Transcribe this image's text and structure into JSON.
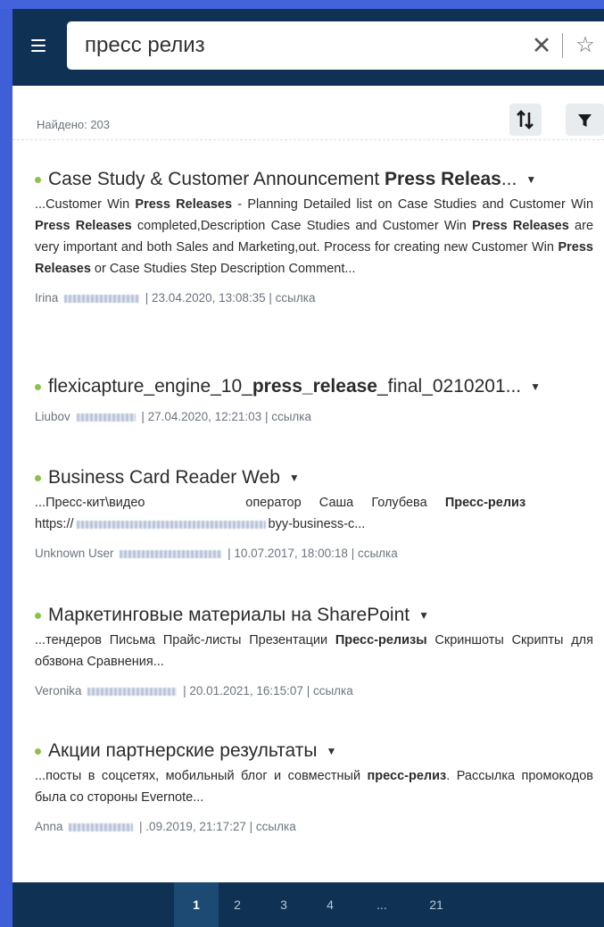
{
  "search": {
    "query": "пресс релиз"
  },
  "toolbar": {
    "found_label": "Найдено: 203"
  },
  "results": [
    {
      "title_before": "Case Study & Customer Announcement ",
      "title_bold": "Press Releas",
      "title_after": "...",
      "snippet_html": "...Customer Win <b>Press Releases</b> - Planning Detailed list on Case Studies and Customer Win <b>Press Releases</b> completed,Description Case Studies and Customer Win <b>Press Releases</b> are very important and both Sales and Marketing,out. Process for creating new Customer Win <b>Press Releases</b> or Case Studies Step Description Comment...",
      "author": "Irina",
      "date": "23.04.2020, 13:08:35",
      "link": "ссылка"
    },
    {
      "title_before": "flexicapture_engine_10_",
      "title_bold": "press_release",
      "title_after": "_final_0210201...",
      "snippet_html": "",
      "author": "Liubov",
      "date": "27.04.2020, 12:21:03",
      "link": "ссылка"
    },
    {
      "title_before": "Business Card Reader Web",
      "title_bold": "",
      "title_after": "",
      "snippet_html": "...Пресс-кит\\видео&nbsp;&nbsp;&nbsp;&nbsp;&nbsp;&nbsp;&nbsp;&nbsp;&nbsp;&nbsp;&nbsp;&nbsp;&nbsp;&nbsp;&nbsp;&nbsp;&nbsp;&nbsp;&nbsp;&nbsp;&nbsp;&nbsp;&nbsp;&nbsp;&nbsp;&nbsp;&nbsp;&nbsp;оператор&nbsp;&nbsp;&nbsp;&nbsp;&nbsp;Саша&nbsp;&nbsp;&nbsp;&nbsp;&nbsp;Голубева&nbsp;&nbsp;&nbsp;&nbsp;&nbsp;<b>Пресс-релиз</b><br>https://<span class=\"blur\" style=\"width:212px\"></span>byy-business-c...",
      "author": "Unknown User",
      "date": "10.07.2017, 18:00:18",
      "link": "ссылка"
    },
    {
      "title_before": "Маркетинговые материалы на SharePoint",
      "title_bold": "",
      "title_after": "",
      "snippet_html": "...тендеров Письма Прайс-листы Презентации <b>Пресс-релизы</b> Скриншоты Скрипты для обзвона Сравнения...",
      "author": "Veronika",
      "date": "20.01.2021, 16:15:07",
      "link": "ссылка"
    },
    {
      "title_before": "Акции партнерские результаты",
      "title_bold": "",
      "title_after": "",
      "snippet_html": "...посты в соцсетях, мобильный блог и совместный <b>пресс-релиз</b>. Рассылка промокодов была со стороны Evernote...",
      "author": "Anna",
      "date": ".09.2019, 21:17:27",
      "link": "ссылка"
    }
  ],
  "pagination": {
    "pages": [
      "1",
      "2",
      "3",
      "4",
      "...",
      "21"
    ],
    "active": "1"
  },
  "icons": {
    "menu": "hamburger-menu-icon",
    "clear": "close-icon",
    "favorite": "star-outline-icon",
    "sort": "sort-arrows-icon",
    "filter": "filter-funnel-icon",
    "expand": "caret-down-icon"
  },
  "colors": {
    "header": "#0f3254",
    "accent_dot": "#8bc34a",
    "page_bg": "#3f5fd8"
  }
}
